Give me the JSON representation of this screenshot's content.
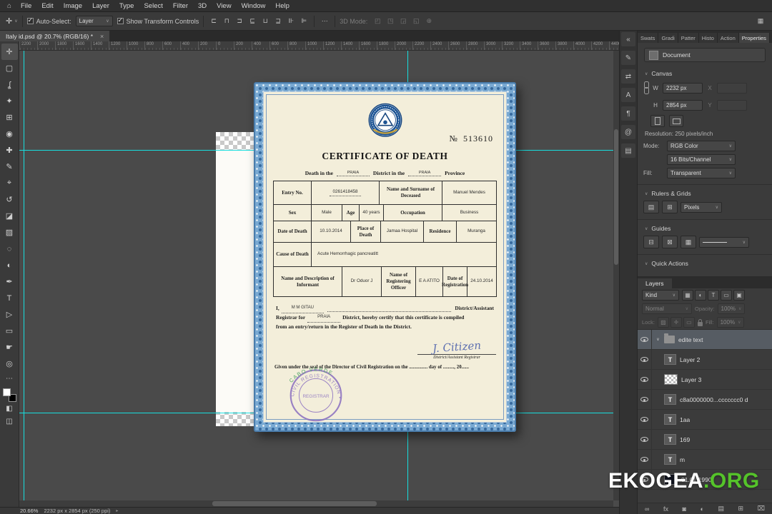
{
  "menubar": {
    "home_glyph": "⌂",
    "items": [
      "File",
      "Edit",
      "Image",
      "Layer",
      "Type",
      "Select",
      "Filter",
      "3D",
      "View",
      "Window",
      "Help"
    ]
  },
  "optionsbar": {
    "tool_glyph": "✛",
    "auto_select_label": "Auto-Select:",
    "auto_select_value": "Layer",
    "show_transform_label": "Show Transform Controls",
    "align_icons": [
      {
        "name": "align-left-icon",
        "glyph": "⊏"
      },
      {
        "name": "align-center-horizontal-icon",
        "glyph": "⊓"
      },
      {
        "name": "align-right-icon",
        "glyph": "⊐"
      },
      {
        "name": "align-top-icon",
        "glyph": "⊑"
      },
      {
        "name": "align-middle-icon",
        "glyph": "⊔"
      },
      {
        "name": "align-bottom-icon",
        "glyph": "⊒"
      },
      {
        "name": "distribute-horizontal-icon",
        "glyph": "⊪"
      },
      {
        "name": "distribute-vertical-icon",
        "glyph": "⊫"
      }
    ],
    "ellipsis": "⋯",
    "mode_3d_label": "3D Mode:",
    "mode_3d_icons": [
      {
        "name": "3d-orbit-icon",
        "glyph": "◰"
      },
      {
        "name": "3d-roll-icon",
        "glyph": "◳"
      },
      {
        "name": "3d-pan-icon",
        "glyph": "◲"
      },
      {
        "name": "3d-slide-icon",
        "glyph": "◱"
      },
      {
        "name": "3d-scale-icon",
        "glyph": "⊕"
      }
    ],
    "workspace_glyph": "▦"
  },
  "document_tab": {
    "title": "Italy id.psd @ 20.7% (RGB/16) *",
    "close_glyph": "×"
  },
  "tools": [
    {
      "name": "move-tool-icon",
      "glyph": "✛",
      "cls": "active"
    },
    {
      "name": "marquee-tool-icon",
      "glyph": "▢",
      "cls": ""
    },
    {
      "name": "lasso-tool-icon",
      "glyph": "ʆ",
      "cls": ""
    },
    {
      "name": "quick-selection-tool-icon",
      "glyph": "✦",
      "cls": ""
    },
    {
      "name": "crop-tool-icon",
      "glyph": "⊞",
      "cls": ""
    },
    {
      "name": "eyedropper-tool-icon",
      "glyph": "◉",
      "cls": ""
    },
    {
      "name": "healing-brush-tool-icon",
      "glyph": "✚",
      "cls": ""
    },
    {
      "name": "brush-tool-icon",
      "glyph": "✎",
      "cls": ""
    },
    {
      "name": "clone-stamp-tool-icon",
      "glyph": "⌖",
      "cls": ""
    },
    {
      "name": "history-brush-tool-icon",
      "glyph": "↺",
      "cls": ""
    },
    {
      "name": "eraser-tool-icon",
      "glyph": "◪",
      "cls": ""
    },
    {
      "name": "gradient-tool-icon",
      "glyph": "▨",
      "cls": ""
    },
    {
      "name": "blur-tool-icon",
      "glyph": "◌",
      "cls": ""
    },
    {
      "name": "dodge-tool-icon",
      "glyph": "◐",
      "cls": ""
    },
    {
      "name": "pen-tool-icon",
      "glyph": "✒",
      "cls": ""
    },
    {
      "name": "type-tool-icon",
      "glyph": "T",
      "cls": ""
    },
    {
      "name": "path-selection-tool-icon",
      "glyph": "▷",
      "cls": ""
    },
    {
      "name": "shape-tool-icon",
      "glyph": "▭",
      "cls": ""
    },
    {
      "name": "hand-tool-icon",
      "glyph": "☛",
      "cls": ""
    },
    {
      "name": "zoom-tool-icon",
      "glyph": "◎",
      "cls": ""
    },
    {
      "name": "edit-toolbar-icon",
      "glyph": "⋯",
      "cls": "small"
    }
  ],
  "toolstrip_bottom": {
    "quick_mask_glyph": "◧",
    "screen_mode_glyph": "◫"
  },
  "ruler_ticks": [
    "2200",
    "2000",
    "1800",
    "1600",
    "1400",
    "1200",
    "1000",
    "800",
    "600",
    "400",
    "200",
    "0",
    "200",
    "400",
    "600",
    "800",
    "1000",
    "1200",
    "1400",
    "1600",
    "1800",
    "2000",
    "2200",
    "2400",
    "2600",
    "2800",
    "3000",
    "3200",
    "3400",
    "3600",
    "3800",
    "4000",
    "4200",
    "4400"
  ],
  "dock_icons": [
    {
      "name": "collapse-panels-icon",
      "glyph": "«"
    },
    {
      "name": "brush-settings-panel-icon",
      "glyph": "✎"
    },
    {
      "name": "swap-panel-icon",
      "glyph": "⇄"
    },
    {
      "name": "character-panel-icon",
      "glyph": "A"
    },
    {
      "name": "paragraph-panel-icon",
      "glyph": "¶"
    },
    {
      "name": "glyphs-panel-icon",
      "glyph": "@"
    },
    {
      "name": "libraries-panel-icon",
      "glyph": "▤"
    }
  ],
  "panel_tabs": [
    "Swats",
    "Gradi",
    "Patter",
    "Histo",
    "Action"
  ],
  "properties_tab": "Properties",
  "properties": {
    "document_label": "Document",
    "canvas_section": "Canvas",
    "w_label": "W",
    "w_value": "2232 px",
    "x_label": "X",
    "h_label": "H",
    "h_value": "2854 px",
    "y_label": "Y",
    "resolution_text": "Resolution: 250 pixels/inch",
    "mode_label": "Mode:",
    "mode_value": "RGB Color",
    "depth_value": "16 Bits/Channel",
    "fill_label": "Fill:",
    "fill_value": "Transparent",
    "rulers_section": "Rulers & Grids",
    "units_value": "Pixels",
    "guides_section": "Guides",
    "quick_actions_section": "Quick Actions"
  },
  "layers": {
    "tab": "Layers",
    "kind_value": "Kind",
    "filter_icons": [
      {
        "name": "filter-pixel-layers-icon",
        "glyph": "▦"
      },
      {
        "name": "filter-adjustment-layers-icon",
        "glyph": "◐"
      },
      {
        "name": "filter-type-layers-icon",
        "glyph": "T"
      },
      {
        "name": "filter-shape-layers-icon",
        "glyph": "▭"
      },
      {
        "name": "filter-smart-objects-icon",
        "glyph": "▣"
      }
    ],
    "blend_value": "Normal",
    "opacity_label": "Opacity:",
    "opacity_value": "100%",
    "lock_label": "Lock:",
    "lock_icons": [
      {
        "name": "lock-transparency-icon",
        "glyph": "▨"
      },
      {
        "name": "lock-position-icon",
        "glyph": "✛"
      },
      {
        "name": "lock-artboard-icon",
        "glyph": "▭"
      }
    ],
    "fill_label": "Fill:",
    "fill_value": "100%",
    "rows": [
      {
        "name": "edite text",
        "icon_name": "group-folder-icon",
        "icon_cls": "ic-folder",
        "cls": "selected",
        "caret": "∨"
      },
      {
        "name": "Layer 2",
        "icon_name": "text-layer-thumbnail",
        "icon_cls": "ic-T",
        "cls": "",
        "caret": ""
      },
      {
        "name": "Layer 3",
        "icon_name": "pixel-layer-thumbnail",
        "icon_cls": "ic-checker",
        "cls": "",
        "caret": ""
      },
      {
        "name": "c8a0000000...ccccccc0 d",
        "icon_name": "text-layer-thumbnail",
        "icon_cls": "ic-T",
        "cls": "",
        "caret": ""
      },
      {
        "name": "1aa",
        "icon_name": "text-layer-thumbnail",
        "icon_cls": "ic-T",
        "cls": "",
        "caret": ""
      },
      {
        "name": "169",
        "icon_name": "text-layer-thumbnail",
        "icon_cls": "ic-T",
        "cls": "",
        "caret": ""
      },
      {
        "name": "m",
        "icon_name": "text-layer-thumbnail",
        "icon_cls": "ic-T",
        "cls": "",
        "caret": ""
      },
      {
        "name": "01.01.1990",
        "icon_name": "pixel-layer-thumbnail",
        "icon_cls": "ic-dark",
        "cls": "",
        "caret": ""
      }
    ],
    "footer_icons": [
      {
        "name": "link-layers-icon",
        "glyph": "∞"
      },
      {
        "name": "layer-style-icon",
        "glyph": "fx"
      },
      {
        "name": "layer-mask-icon",
        "glyph": "◙"
      },
      {
        "name": "adjustment-layer-icon",
        "glyph": "◐"
      },
      {
        "name": "new-group-icon",
        "glyph": "▤"
      },
      {
        "name": "new-layer-icon",
        "glyph": "⊞"
      },
      {
        "name": "delete-layer-icon",
        "glyph": "⌧"
      }
    ]
  },
  "statusbar": {
    "zoom": "20.66%",
    "doc_info": "2232 px x 2854 px (250 ppi)",
    "caret": "▸"
  },
  "watermark": {
    "white": "EKOGEA",
    "green": ".ORG"
  },
  "certificate": {
    "number_label": "№",
    "number": "513610",
    "title": "CERTIFICATE OF DEATH",
    "line1": {
      "death_in": "Death in the",
      "value1": "PRAIA",
      "district_in": "District in the",
      "value2": "PRAIA",
      "province": "Province"
    },
    "table": {
      "entry_label": "Entry No.",
      "entry_value": "0261418458",
      "name_label": "Name and Surname of Deceased",
      "name_value": "Manuel Mendes",
      "sex_label": "Sex",
      "sex_value": "Male",
      "age_label": "Age",
      "age_value": "40 years",
      "occupation_label": "Occupation",
      "occupation_value": "Business",
      "dod_label": "Date of Death",
      "dod_value": "10.10.2014",
      "pod_label": "Place of Death",
      "pod_value": "Jamaa Hospital",
      "residence_label": "Residence",
      "residence_value": "Muranga",
      "cause_label": "Cause of Death",
      "cause_value": "Acute Hemorrhagic pancreatitt",
      "informant_label": "Name and Description of Informant",
      "informant_value": "Dr Oduor J",
      "officer_label": "Name of Registering Officer",
      "officer_value": "E A ATITO",
      "regdate_label": "Date of Registration",
      "regdate_value": "24.10.2014"
    },
    "declaration": {
      "i_label": "I,",
      "registrar_name": "M M GITAU",
      "line1_suffix": "District/Assistant",
      "line2_prefix": "Registrar for",
      "district_value": "PRAIA",
      "line2_suffix": "District, hereby certify that this certificate is compiled",
      "line3": "from an entry/return in the Register of Death in the District."
    },
    "signature_name": "J. Citizen",
    "signature_title": "District/Assistant Registrar",
    "footer_line": "Given under the seal of the Director of Civil Registration on the ............... day of ........., 20......",
    "stamp": {
      "ring_text": "CIVIL REGISTRATION • PRAIA •",
      "green_text": "CABO VERDE",
      "center_text": "REGISTRAR"
    }
  }
}
